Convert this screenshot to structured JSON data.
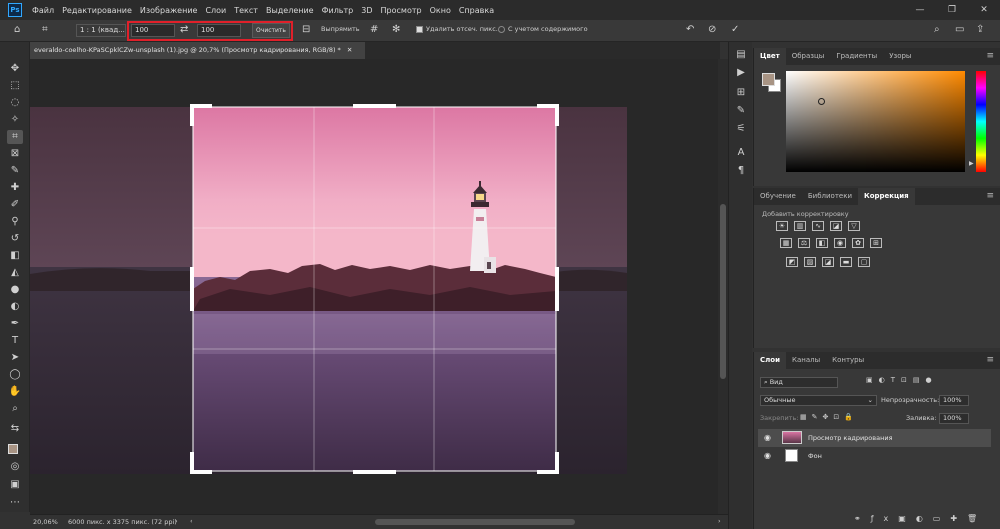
{
  "app": {
    "logo": "Ps"
  },
  "menu": [
    "Файл",
    "Редактирование",
    "Изображение",
    "Слои",
    "Текст",
    "Выделение",
    "Фильтр",
    "3D",
    "Просмотр",
    "Окно",
    "Справка"
  ],
  "window_controls": [
    "—",
    "❐",
    "✕"
  ],
  "options": {
    "ratio_select": "1 : 1 (квад...",
    "width_value": "100",
    "height_value": "100",
    "clear_button": "Очистить",
    "straighten_label": "Выпрямить",
    "delete_pixels_label": "Удалить отсеч. пикс.",
    "content_aware_label": "С учетом содержимого"
  },
  "document": {
    "tab_title": "everaldo-coelho-KPaSCpklCZw-unsplash (1).jpg @ 20,7% (Просмотр кадрирования, RGB/8) *",
    "zoom": "20,06%",
    "size_info": "6000 пикс. x 3375 пикс. (72 ppi)"
  },
  "color_panel": {
    "tabs": [
      "Цвет",
      "Образцы",
      "Градиенты",
      "Узоры"
    ],
    "active": "Цвет"
  },
  "adjust_panel": {
    "tabs": [
      "Обучение",
      "Библиотеки",
      "Коррекция"
    ],
    "active": "Коррекция",
    "hint": "Добавить корректировку"
  },
  "layers_panel": {
    "tabs": [
      "Слои",
      "Каналы",
      "Контуры"
    ],
    "active": "Слои",
    "search_placeholder": "Вид",
    "blend_mode": "Обычные",
    "opacity_label": "Непрозрачность:",
    "opacity_value": "100%",
    "lock_label": "Закрепить:",
    "fill_label": "Заливка:",
    "fill_value": "100%",
    "layers": [
      {
        "name": "Просмотр кадрирования",
        "selected": true
      },
      {
        "name": "Фон",
        "selected": false
      }
    ]
  },
  "colors": {
    "crop_sky_top": "#e07aa6",
    "crop_sky_bottom": "#f3b0c7",
    "outside_tint": "#4a3a48",
    "accent_red": "#e0202a"
  }
}
